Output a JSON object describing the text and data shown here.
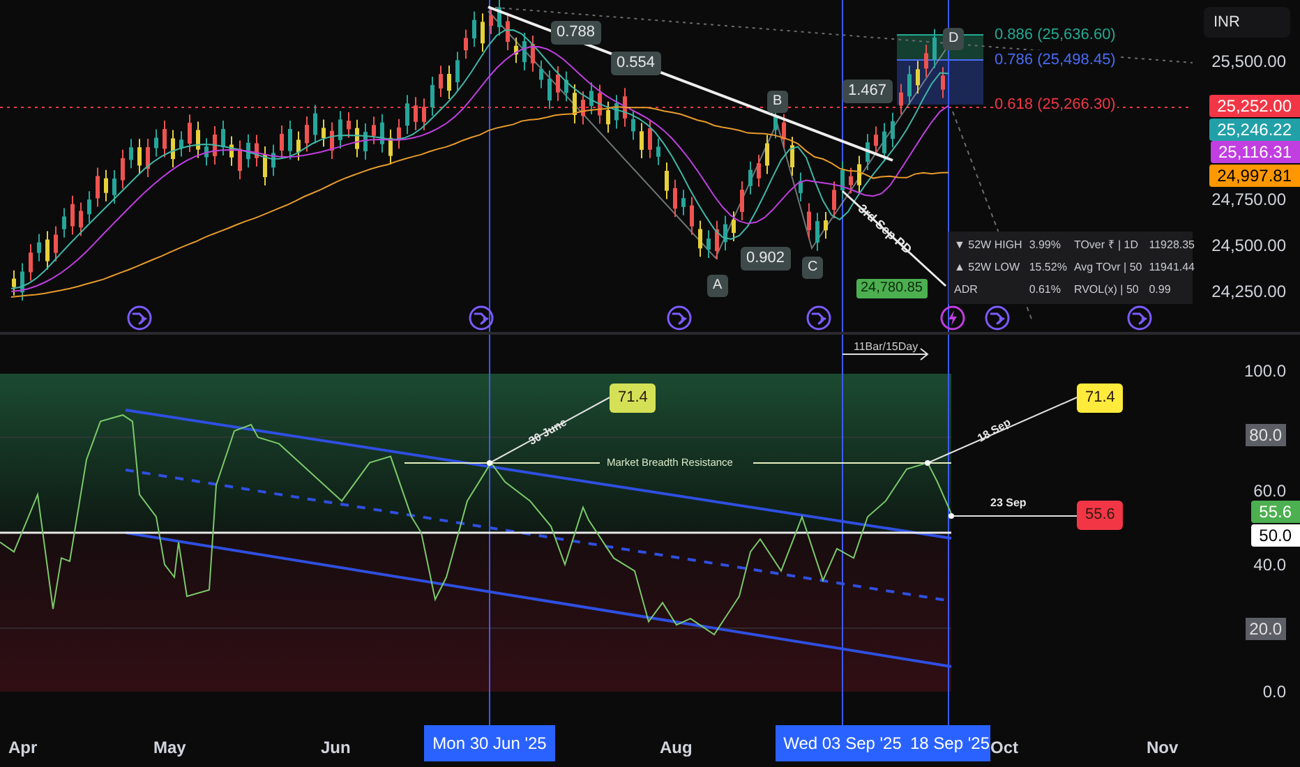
{
  "price_pane": {
    "currency": "INR",
    "axis_labels": [
      {
        "text": "25,500.00",
        "kind": "tick"
      },
      {
        "text": "25,252.00",
        "kind": "badge",
        "color": "#f23645"
      },
      {
        "text": "25,246.22",
        "kind": "badge",
        "color": "#22a0a8"
      },
      {
        "text": "25,116.31",
        "kind": "badge",
        "color": "#c13ee0"
      },
      {
        "text": "24,997.81",
        "kind": "badge",
        "color": "#ff9800"
      },
      {
        "text": "24,750.00",
        "kind": "tick"
      },
      {
        "text": "24,500.00",
        "kind": "tick"
      },
      {
        "text": "24,250.00",
        "kind": "tick"
      }
    ],
    "fib_levels": [
      {
        "text": "0.886 (25,636.60)",
        "color": "#22ab94"
      },
      {
        "text": "0.786 (25,498.45)",
        "color": "#4a6cf7"
      },
      {
        "text": "0.618 (25,266.30)",
        "color": "#f23645"
      }
    ],
    "ratio_labels": [
      "0.788",
      "0.554",
      "1.467",
      "0.902"
    ],
    "point_labels": [
      "B",
      "D",
      "A",
      "C"
    ],
    "annotation": "3rd Sep PD",
    "price_tag": "24,780.85",
    "stats_table": [
      [
        "▼ 52W HIGH",
        "3.99%",
        "TOver ₹ | 1D",
        "11928.35"
      ],
      [
        "▲ 52W LOW",
        "15.52%",
        "Avg TOvr | 50",
        "11941.44"
      ],
      [
        "ADR",
        "0.61%",
        "RVOL(x) | 50",
        "0.99"
      ]
    ]
  },
  "indicator_pane": {
    "span_label": "11Bar/15Day",
    "resistance_label": "Market Breadth Resistance",
    "callouts": [
      {
        "date": "30 June",
        "value": "71.4",
        "color": "#d4e157"
      },
      {
        "date": "18 Sep",
        "value": "71.4",
        "color": "#ffeb3b"
      },
      {
        "date": "23 Sep",
        "value": "55.6",
        "color": "#f23645"
      }
    ],
    "axis_labels": [
      {
        "text": "100.0",
        "kind": "tick"
      },
      {
        "text": "80.0",
        "kind": "boxed"
      },
      {
        "text": "60.0",
        "kind": "tick"
      },
      {
        "text": "55.6",
        "kind": "badge",
        "color": "#4caf50"
      },
      {
        "text": "50.0",
        "kind": "badge",
        "color": "#ffffff"
      },
      {
        "text": "40.0",
        "kind": "tick"
      },
      {
        "text": "20.0",
        "kind": "boxed"
      },
      {
        "text": "0.0",
        "kind": "tick"
      }
    ]
  },
  "time_axis": {
    "months": [
      "Apr",
      "May",
      "Jun",
      "Aug",
      "Oct",
      "Nov"
    ],
    "cursor_labels": [
      "Mon 30 Jun '25",
      "Wed 03 Sep '25",
      "18 Sep '25"
    ]
  }
}
